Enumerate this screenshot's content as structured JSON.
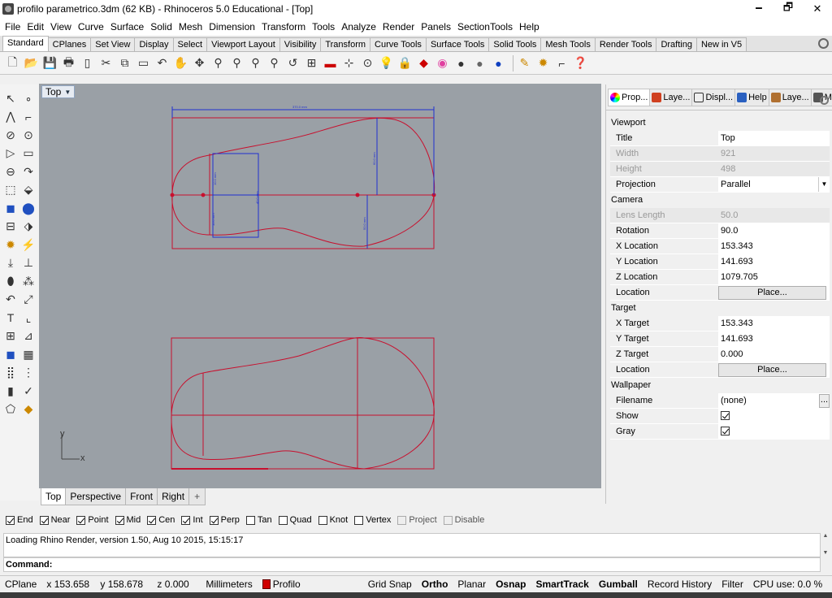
{
  "window": {
    "title": "profilo parametrico.3dm (62 KB) - Rhinoceros 5.0 Educational - [Top]",
    "minimize_glyph": "🗕",
    "maximize_glyph": "🗗",
    "close_glyph": "✕"
  },
  "menu": [
    "File",
    "Edit",
    "View",
    "Curve",
    "Surface",
    "Solid",
    "Mesh",
    "Dimension",
    "Transform",
    "Tools",
    "Analyze",
    "Render",
    "Panels",
    "SectionTools",
    "Help"
  ],
  "toolbar_tabs": [
    "Standard",
    "CPlanes",
    "Set View",
    "Display",
    "Select",
    "Viewport Layout",
    "Visibility",
    "Transform",
    "Curve Tools",
    "Surface Tools",
    "Solid Tools",
    "Mesh Tools",
    "Render Tools",
    "Drafting",
    "New in V5"
  ],
  "toolbar_icons": [
    "new-file",
    "open-file",
    "save",
    "print",
    "import",
    "cut",
    "copy",
    "paste",
    "undo",
    "pan",
    "rotate-view",
    "zoom-dynamic",
    "zoom-window",
    "zoom-extents",
    "zoom-selected",
    "zoom-all",
    "four-viewports",
    "car",
    "grid",
    "points",
    "light",
    "lock",
    "mesh",
    "color-wheel",
    "shaded",
    "rendered",
    "render-sphere",
    "material",
    "osnap",
    "filter",
    "help"
  ],
  "viewport": {
    "label": "Top",
    "axis_x": "x",
    "axis_y": "y",
    "dim_top": "370.0 mm",
    "dim_vertical_right": "60.0 mm",
    "dim_lower_right": "50.0 mm",
    "dim_box_top": "10.0 mm",
    "dim_box_right": "40.0 mm",
    "dim_box_bottom": "10.0 mm"
  },
  "viewport_tabs": [
    "Top",
    "Perspective",
    "Front",
    "Right"
  ],
  "viewport_tab_add": "+",
  "panel": {
    "tabs": [
      "Prop...",
      "Laye...",
      "Displ...",
      "Help",
      "Laye...",
      "Mesh..."
    ],
    "sections": {
      "viewport": "Viewport",
      "camera": "Camera",
      "target": "Target",
      "wallpaper": "Wallpaper"
    },
    "rows": {
      "title": {
        "k": "Title",
        "v": "Top"
      },
      "width": {
        "k": "Width",
        "v": "921"
      },
      "height": {
        "k": "Height",
        "v": "498"
      },
      "projection": {
        "k": "Projection",
        "v": "Parallel"
      },
      "lens": {
        "k": "Lens Length",
        "v": "50.0"
      },
      "rotation": {
        "k": "Rotation",
        "v": "90.0"
      },
      "xloc": {
        "k": "X Location",
        "v": "153.343"
      },
      "yloc": {
        "k": "Y Location",
        "v": "141.693"
      },
      "zloc": {
        "k": "Z Location",
        "v": "1079.705"
      },
      "cam_loc": {
        "k": "Location",
        "v": "Place..."
      },
      "xtarget": {
        "k": "X Target",
        "v": "153.343"
      },
      "ytarget": {
        "k": "Y Target",
        "v": "141.693"
      },
      "ztarget": {
        "k": "Z Target",
        "v": "0.000"
      },
      "tgt_loc": {
        "k": "Location",
        "v": "Place..."
      },
      "filename": {
        "k": "Filename",
        "v": "(none)",
        "btn": "..."
      },
      "show": {
        "k": "Show"
      },
      "gray": {
        "k": "Gray"
      }
    }
  },
  "osnap": [
    {
      "label": "End",
      "checked": true
    },
    {
      "label": "Near",
      "checked": true
    },
    {
      "label": "Point",
      "checked": true
    },
    {
      "label": "Mid",
      "checked": true
    },
    {
      "label": "Cen",
      "checked": true
    },
    {
      "label": "Int",
      "checked": true
    },
    {
      "label": "Perp",
      "checked": true
    },
    {
      "label": "Tan",
      "checked": false
    },
    {
      "label": "Quad",
      "checked": false
    },
    {
      "label": "Knot",
      "checked": false
    },
    {
      "label": "Vertex",
      "checked": false
    },
    {
      "label": "Project",
      "checked": false
    },
    {
      "label": "Disable",
      "checked": false
    }
  ],
  "command": {
    "history": "Loading Rhino Render, version 1.50, Aug 10 2015, 15:15:17",
    "prompt": "Command:"
  },
  "status": {
    "cplane": "CPlane",
    "x": "x 153.658",
    "y": "y 158.678",
    "z": "z 0.000",
    "units": "Millimeters",
    "layer": "Profilo",
    "grid_snap": "Grid Snap",
    "ortho": "Ortho",
    "planar": "Planar",
    "osnap": "Osnap",
    "smarttrack": "SmartTrack",
    "gumball": "Gumball",
    "record_history": "Record History",
    "filter": "Filter",
    "cpu": "CPU use: 0.0 %"
  },
  "colors": {
    "viewport_bg": "#9aa0a6",
    "curve": "#c8102e",
    "dimension": "#2030d0"
  }
}
